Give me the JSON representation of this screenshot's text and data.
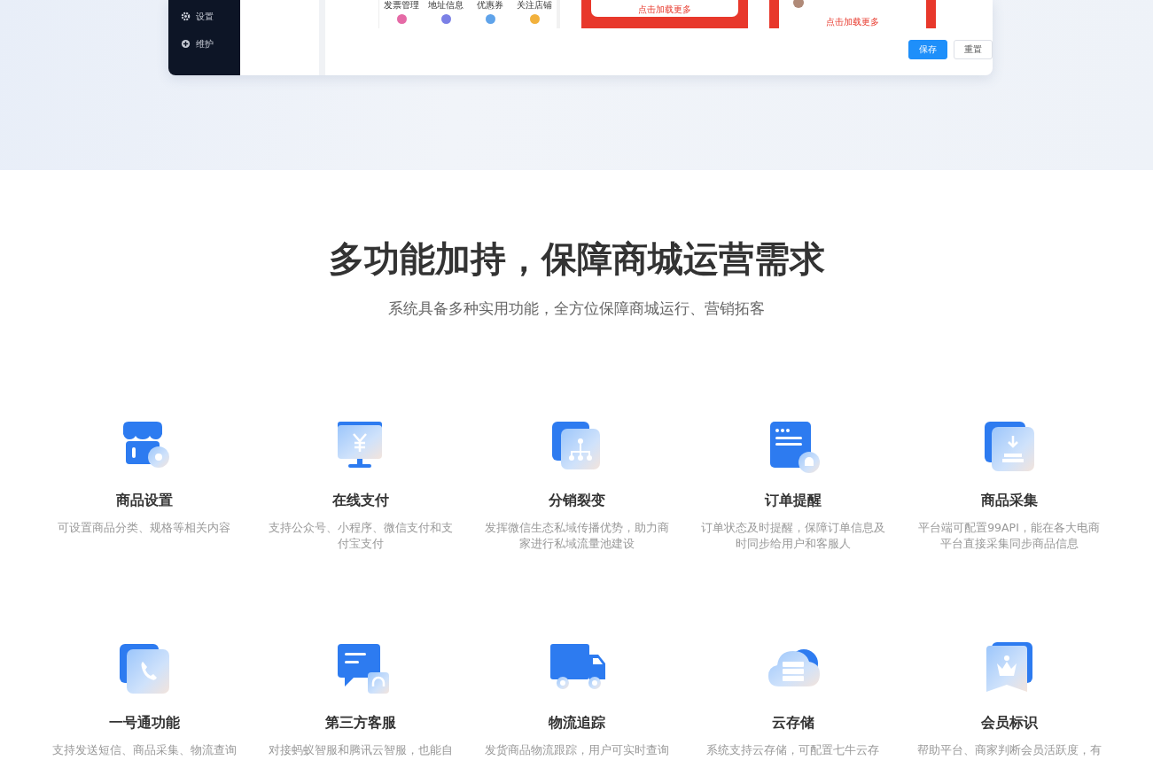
{
  "admin_preview": {
    "sidebar_items": [
      {
        "label": "设置",
        "kind": "gear"
      },
      {
        "label": "维护",
        "kind": "plus"
      }
    ],
    "shortcuts": [
      {
        "label": "发票管理",
        "color": "#e56aa6"
      },
      {
        "label": "地址信息",
        "color": "#7b80e6"
      },
      {
        "label": "优惠券",
        "color": "#5fa3ea"
      },
      {
        "label": "关注店铺",
        "color": "#f2b13c"
      }
    ],
    "panels": [
      {
        "kind": "plain",
        "link": "点击加载更多"
      },
      {
        "kind": "order",
        "link": "点击加载更多"
      }
    ],
    "buttons": [
      {
        "label": "保存",
        "kind": "primary"
      },
      {
        "label": "重置",
        "kind": "default"
      }
    ]
  },
  "features": {
    "title": "多功能加持，保障商城运营需求",
    "subtitle": "系统具备多种实用功能，全方位保障商城运行、营销拓客",
    "items": [
      {
        "kind": "store",
        "title": "商品设置",
        "description": "可设置商品分类、规格等相关内容"
      },
      {
        "kind": "monitor",
        "title": "在线支付",
        "description": "支持公众号、小程序、微信支付和支付宝支付"
      },
      {
        "kind": "share",
        "title": "分销裂变",
        "description": "发挥微信生态私域传播优势，助力商家进行私域流量池建设"
      },
      {
        "kind": "document",
        "title": "订单提醒",
        "description": "订单状态及时提醒，保障订单信息及时同步给用户和客服人"
      },
      {
        "kind": "download",
        "title": "商品采集",
        "description": "平台端可配置99API，能在各大电商平台直接采集同步商品信息"
      },
      {
        "kind": "phone",
        "title": "一号通功能",
        "description": "支持发送短信、商品采集、物流查询"
      },
      {
        "kind": "chat",
        "title": "第三方客服",
        "description": "对接蚂蚁智服和腾讯云智服，也能自"
      },
      {
        "kind": "truck",
        "title": "物流追踪",
        "description": "发货商品物流跟踪，用户可实时查询"
      },
      {
        "kind": "cloud",
        "title": "云存储",
        "description": "系统支持云存储，可配置七牛云存"
      },
      {
        "kind": "crown",
        "title": "会员标识",
        "description": "帮助平台、商家判断会员活跃度，有"
      }
    ]
  }
}
